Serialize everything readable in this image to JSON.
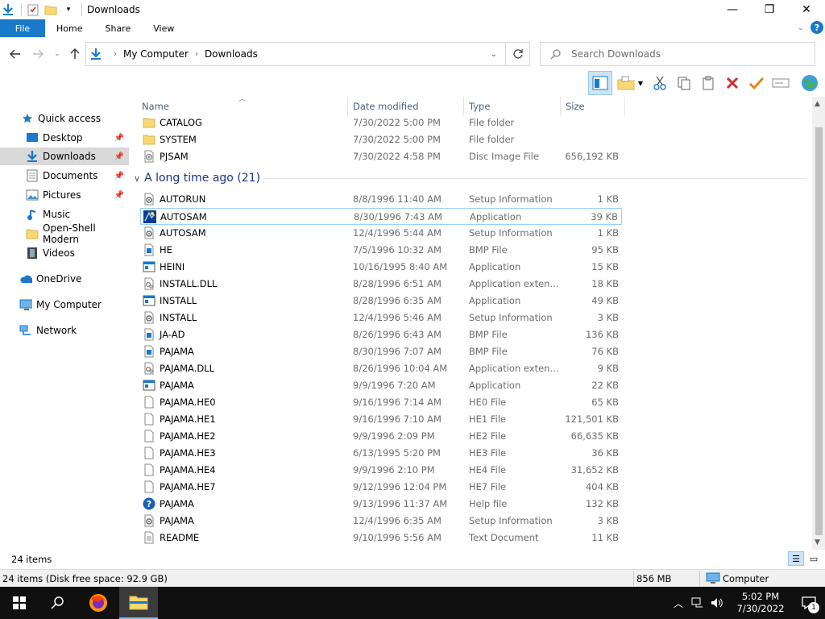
{
  "window": {
    "title": "Downloads",
    "minimize": "—",
    "maximize": "❐",
    "close": "✕"
  },
  "ribbon": {
    "tabs": [
      "File",
      "Home",
      "Share",
      "View"
    ]
  },
  "address": {
    "crumbs": [
      "My Computer",
      "Downloads"
    ],
    "search_placeholder": "Search Downloads"
  },
  "navigation": {
    "items": [
      {
        "label": "Quick access",
        "icon": "star-icon"
      },
      {
        "label": "Desktop",
        "icon": "desktop-icon",
        "pinned": true
      },
      {
        "label": "Downloads",
        "icon": "download-icon",
        "pinned": true,
        "selected": true
      },
      {
        "label": "Documents",
        "icon": "documents-icon",
        "pinned": true
      },
      {
        "label": "Pictures",
        "icon": "pictures-icon",
        "pinned": true
      },
      {
        "label": "Music",
        "icon": "music-icon"
      },
      {
        "label": "Open-Shell Modern",
        "icon": "folder-icon"
      },
      {
        "label": "Videos",
        "icon": "videos-icon"
      },
      {
        "label": "OneDrive",
        "icon": "cloud-icon"
      },
      {
        "label": "My Computer",
        "icon": "computer-icon"
      },
      {
        "label": "Network",
        "icon": "network-icon"
      }
    ]
  },
  "columns": {
    "name": "Name",
    "date": "Date modified",
    "type": "Type",
    "size": "Size"
  },
  "recent_files": [
    {
      "name": "CATALOG",
      "date": "7/30/2022 5:00 PM",
      "type": "File folder",
      "size": "",
      "icon": "folder-icon"
    },
    {
      "name": "SYSTEM",
      "date": "7/30/2022 5:00 PM",
      "type": "File folder",
      "size": "",
      "icon": "folder-icon"
    },
    {
      "name": "PJSAM",
      "date": "7/30/2022 4:58 PM",
      "type": "Disc Image File",
      "size": "656,192 KB",
      "icon": "disc-image-icon"
    }
  ],
  "group": {
    "label": "A long time ago (21)"
  },
  "old_files": [
    {
      "name": "AUTORUN",
      "date": "8/8/1996 11:40 AM",
      "type": "Setup Information",
      "size": "1 KB",
      "icon": "setup-info-icon"
    },
    {
      "name": "AUTOSAM",
      "date": "8/30/1996 7:43 AM",
      "type": "Application",
      "size": "39 KB",
      "icon": "autosam-app-icon"
    },
    {
      "name": "AUTOSAM",
      "date": "12/4/1996 5:44 AM",
      "type": "Setup Information",
      "size": "1 KB",
      "icon": "setup-info-icon"
    },
    {
      "name": "HE",
      "date": "7/5/1996 10:32 AM",
      "type": "BMP File",
      "size": "95 KB",
      "icon": "bmp-file-icon"
    },
    {
      "name": "HEINI",
      "date": "10/16/1995 8:40 AM",
      "type": "Application",
      "size": "15 KB",
      "icon": "application-icon"
    },
    {
      "name": "INSTALL.DLL",
      "date": "8/28/1996 6:51 AM",
      "type": "Application exten...",
      "size": "18 KB",
      "icon": "dll-file-icon"
    },
    {
      "name": "INSTALL",
      "date": "8/28/1996 6:35 AM",
      "type": "Application",
      "size": "49 KB",
      "icon": "application-icon"
    },
    {
      "name": "INSTALL",
      "date": "12/4/1996 5:46 AM",
      "type": "Setup Information",
      "size": "3 KB",
      "icon": "setup-info-icon"
    },
    {
      "name": "JA-AD",
      "date": "8/26/1996 6:43 AM",
      "type": "BMP File",
      "size": "136 KB",
      "icon": "bmp-file-icon"
    },
    {
      "name": "PAJAMA",
      "date": "8/30/1996 7:07 AM",
      "type": "BMP File",
      "size": "76 KB",
      "icon": "bmp-file-icon"
    },
    {
      "name": "PAJAMA.DLL",
      "date": "8/26/1996 10:04 AM",
      "type": "Application exten...",
      "size": "9 KB",
      "icon": "dll-file-icon"
    },
    {
      "name": "PAJAMA",
      "date": "9/9/1996 7:20 AM",
      "type": "Application",
      "size": "22 KB",
      "icon": "application-icon"
    },
    {
      "name": "PAJAMA.HE0",
      "date": "9/16/1996 7:14 AM",
      "type": "HE0 File",
      "size": "65 KB",
      "icon": "blank-file-icon"
    },
    {
      "name": "PAJAMA.HE1",
      "date": "9/16/1996 7:10 AM",
      "type": "HE1 File",
      "size": "121,501 KB",
      "icon": "blank-file-icon"
    },
    {
      "name": "PAJAMA.HE2",
      "date": "9/9/1996 2:09 PM",
      "type": "HE2 File",
      "size": "66,635 KB",
      "icon": "blank-file-icon"
    },
    {
      "name": "PAJAMA.HE3",
      "date": "6/13/1995 5:20 PM",
      "type": "HE3 File",
      "size": "36 KB",
      "icon": "blank-file-icon"
    },
    {
      "name": "PAJAMA.HE4",
      "date": "9/9/1996 2:10 PM",
      "type": "HE4 File",
      "size": "31,652 KB",
      "icon": "blank-file-icon"
    },
    {
      "name": "PAJAMA.HE7",
      "date": "9/12/1996 12:04 PM",
      "type": "HE7 File",
      "size": "404 KB",
      "icon": "blank-file-icon"
    },
    {
      "name": "PAJAMA",
      "date": "9/13/1996 11:37 AM",
      "type": "Help file",
      "size": "132 KB",
      "icon": "help-file-icon"
    },
    {
      "name": "PAJAMA",
      "date": "12/4/1996 6:35 AM",
      "type": "Setup Information",
      "size": "3 KB",
      "icon": "setup-info-icon"
    },
    {
      "name": "README",
      "date": "9/10/1996 5:56 AM",
      "type": "Text Document",
      "size": "11 KB",
      "icon": "text-file-icon"
    }
  ],
  "status": {
    "item_count": "24 items",
    "disk_info": "24 items (Disk free space: 92.9 GB)",
    "size": "856 MB",
    "location": "Computer"
  },
  "taskbar": {
    "time": "5:02 PM",
    "date": "7/30/2022",
    "notifications": "1"
  },
  "colors": {
    "accent": "#1979ca",
    "selection": "#cce4f7",
    "group_header": "#1e3287"
  }
}
